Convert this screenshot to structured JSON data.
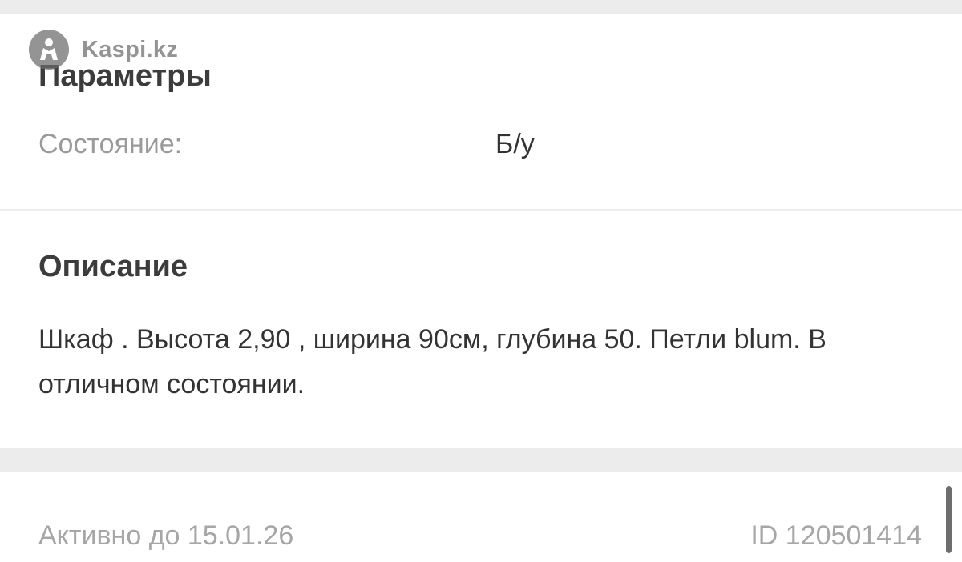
{
  "watermark": {
    "text": "Kaspi.kz",
    "icon": "kaspi-logo-icon"
  },
  "parameters": {
    "title": "Параметры",
    "items": [
      {
        "label": "Состояние:",
        "value": "Б/у"
      }
    ]
  },
  "description": {
    "title": "Описание",
    "text": "Шкаф . Высота 2,90 , ширина 90см, глубина 50. Петли blum. В отличном состоянии."
  },
  "footer": {
    "active_until": "Активно до 15.01.26",
    "ad_id": "ID 120501414"
  },
  "colors": {
    "background": "#ececec",
    "card": "#ffffff",
    "title_text": "#3c3c3c",
    "label_text": "#9a9a9a",
    "body_text": "#333333"
  }
}
